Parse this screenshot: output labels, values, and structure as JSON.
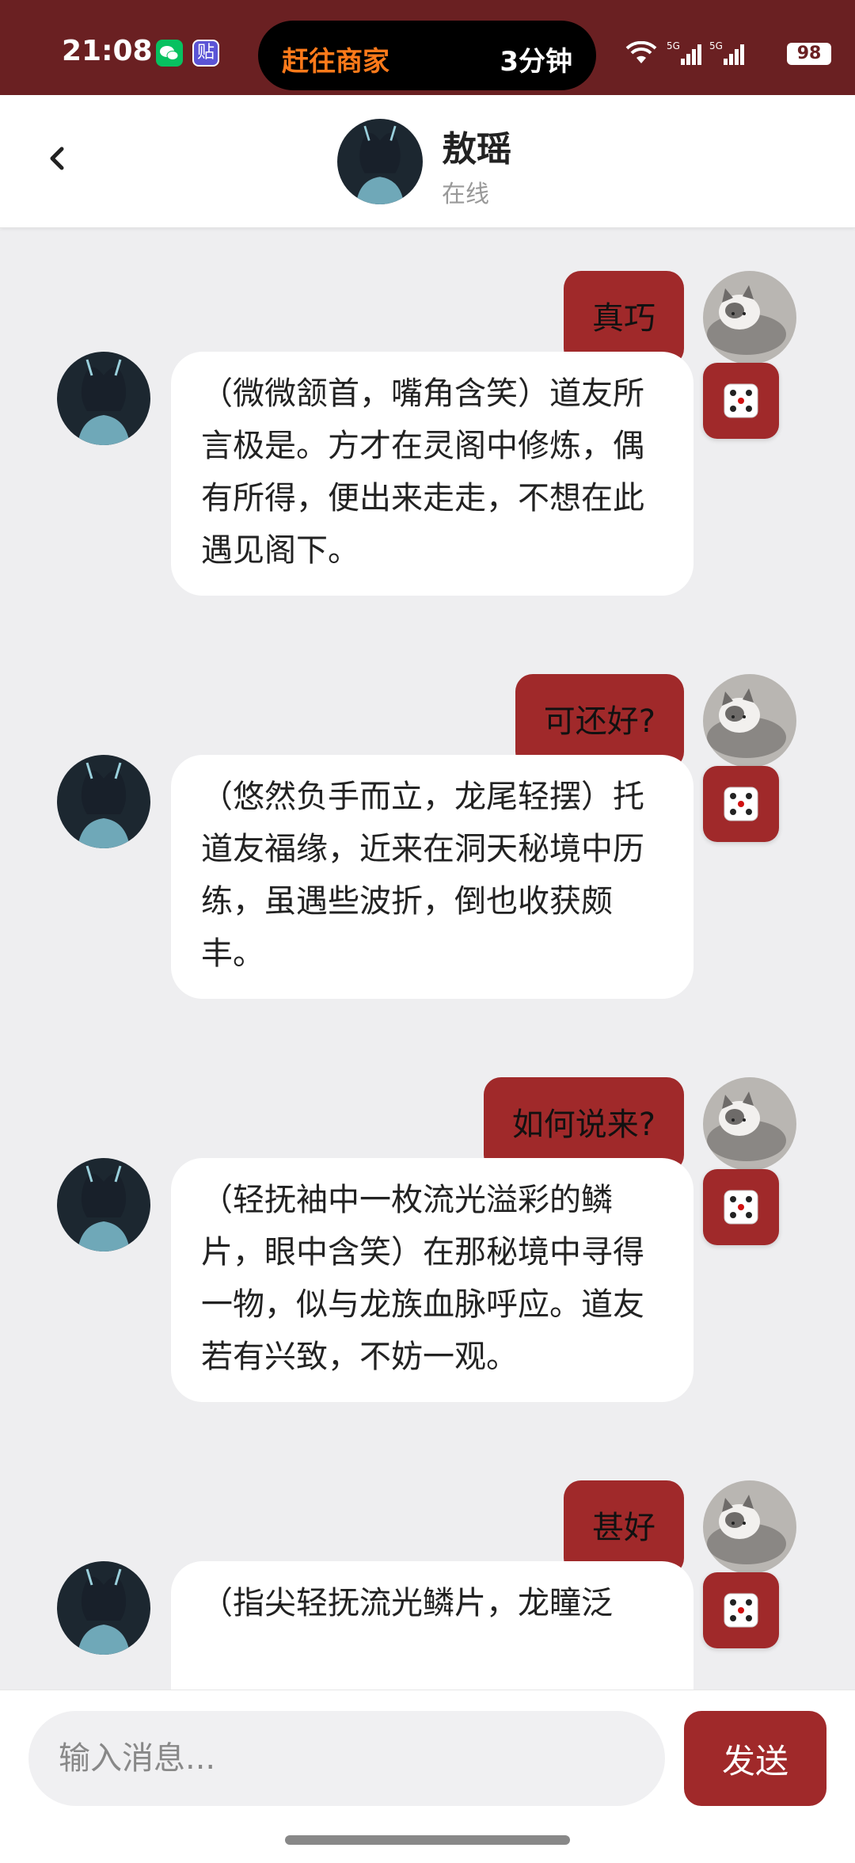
{
  "status_bar": {
    "time": "21:08",
    "island_left": "赶往商家",
    "island_right": "3分钟",
    "battery": "98",
    "tieba_icon_text": "贴"
  },
  "header": {
    "name": "敖瑶",
    "status": "在线"
  },
  "messages": [
    {
      "role": "user",
      "text": "真巧"
    },
    {
      "role": "ai",
      "text": "（微微颔首，嘴角含笑）道友所言极是。方才在灵阁中修炼，偶有所得，便出来走走，不想在此遇见阁下。"
    },
    {
      "role": "user",
      "text": "可还好?"
    },
    {
      "role": "ai",
      "text": "（悠然负手而立，龙尾轻摆）托道友福缘，近来在洞天秘境中历练，虽遇些波折，倒也收获颇丰。"
    },
    {
      "role": "user",
      "text": "如何说来?"
    },
    {
      "role": "ai",
      "text": "（轻抚袖中一枚流光溢彩的鳞片，眼中含笑）在那秘境中寻得一物，似与龙族血脉呼应。道友若有兴致，不妨一观。"
    },
    {
      "role": "user",
      "text": "甚好"
    },
    {
      "role": "ai",
      "text": "（指尖轻抚流光鳞片，龙瞳泛"
    }
  ],
  "input": {
    "placeholder": "输入消息...",
    "send_label": "发送"
  },
  "colors": {
    "accent": "#a0292a",
    "status_bar": "#6a2022",
    "island_text": "#ff7a1a",
    "chat_bg": "#eeeef0"
  },
  "icons": {
    "back": "chevron-left-icon",
    "dice": "dice-icon",
    "wifi": "wifi-icon",
    "signal": "signal-icon"
  }
}
